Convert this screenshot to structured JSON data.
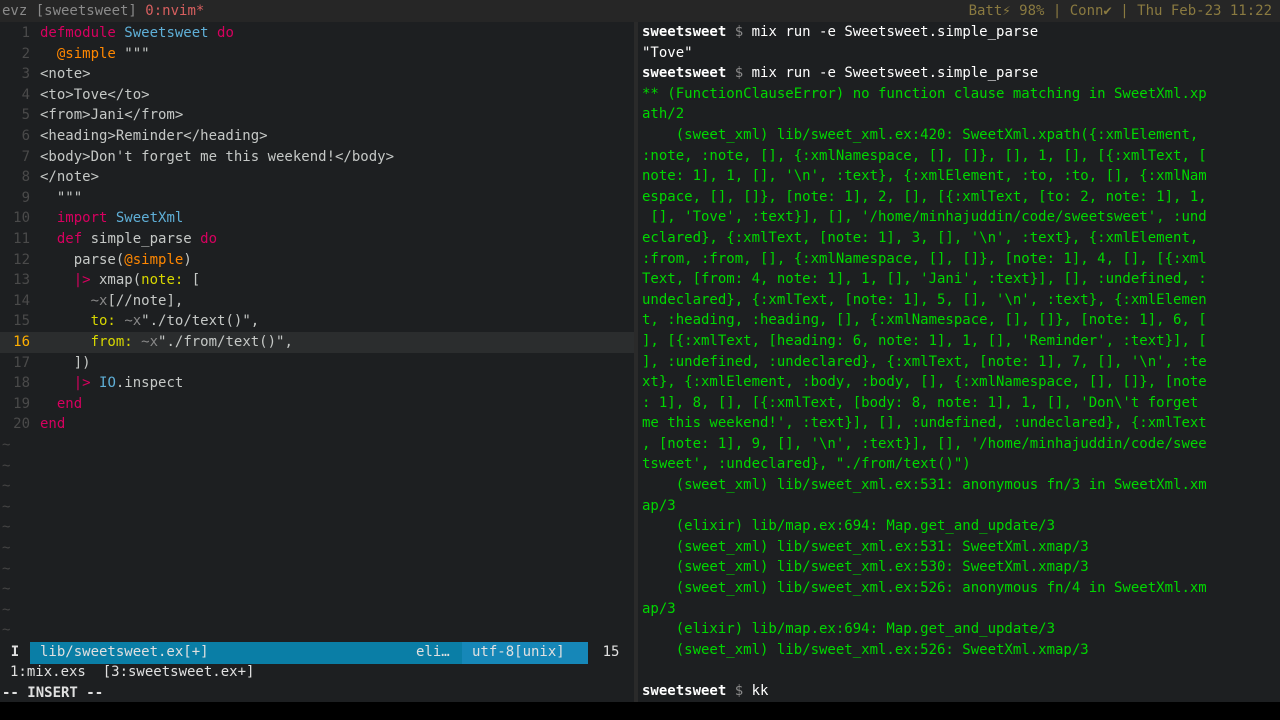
{
  "tmux": {
    "session": "evz [sweetsweet]",
    "window": "0:nvim*",
    "status_right": "Batt⚡ 98% | Conn✔ | Thu Feb-23 11:22"
  },
  "editor": {
    "lines": [
      {
        "n": "1",
        "text": "defmodule Sweetsweet do"
      },
      {
        "n": "2",
        "text": "  @simple \"\"\""
      },
      {
        "n": "3",
        "text": "<note>"
      },
      {
        "n": "4",
        "text": "<to>Tove</to>"
      },
      {
        "n": "5",
        "text": "<from>Jani</from>"
      },
      {
        "n": "6",
        "text": "<heading>Reminder</heading>"
      },
      {
        "n": "7",
        "text": "<body>Don't forget me this weekend!</body>"
      },
      {
        "n": "8",
        "text": "</note>"
      },
      {
        "n": "9",
        "text": "  \"\"\""
      },
      {
        "n": "10",
        "text": "  import SweetXml"
      },
      {
        "n": "11",
        "text": "  def simple_parse do"
      },
      {
        "n": "12",
        "text": "    parse(@simple)"
      },
      {
        "n": "13",
        "text": "    |> xmap(note: ["
      },
      {
        "n": "14",
        "text": "      ~x[//note],"
      },
      {
        "n": "15",
        "text": "      to: ~x\"./to/text()\","
      },
      {
        "n": "16",
        "text": "      from: ~x\"./from/text()\","
      },
      {
        "n": "17",
        "text": "    ])"
      },
      {
        "n": "18",
        "text": "    |> IO.inspect"
      },
      {
        "n": "19",
        "text": "  end"
      },
      {
        "n": "20",
        "text": "end"
      }
    ],
    "current_line": "16",
    "tilde": "~",
    "status": {
      "mode_char": "I",
      "file": "lib/sweetsweet.ex[+]",
      "filetype": "eli…",
      "encoding": "utf-8[unix]",
      "position": "15"
    },
    "buffers": "1:mix.exs  [3:sweetsweet.ex+]",
    "mode_line": "-- INSERT --"
  },
  "terminal": {
    "prompt_user": "sweetsweet",
    "prompt_symbol": "$",
    "cmd1": "mix run -e Sweetsweet.simple_parse",
    "out1": "\"Tove\"",
    "cmd2": "mix run -e Sweetsweet.simple_parse",
    "error_lines": [
      "** (FunctionClauseError) no function clause matching in SweetXml.xp",
      "ath/2",
      "    (sweet_xml) lib/sweet_xml.ex:420: SweetXml.xpath({:xmlElement,",
      ":note, :note, [], {:xmlNamespace, [], []}, [], 1, [], [{:xmlText, [",
      "note: 1], 1, [], '\\n', :text}, {:xmlElement, :to, :to, [], {:xmlNam",
      "espace, [], []}, [note: 1], 2, [], [{:xmlText, [to: 2, note: 1], 1,",
      " [], 'Tove', :text}], [], '/home/minhajuddin/code/sweetsweet', :und",
      "eclared}, {:xmlText, [note: 1], 3, [], '\\n', :text}, {:xmlElement,",
      ":from, :from, [], {:xmlNamespace, [], []}, [note: 1], 4, [], [{:xml",
      "Text, [from: 4, note: 1], 1, [], 'Jani', :text}], [], :undefined, :",
      "undeclared}, {:xmlText, [note: 1], 5, [], '\\n', :text}, {:xmlElemen",
      "t, :heading, :heading, [], {:xmlNamespace, [], []}, [note: 1], 6, [",
      "], [{:xmlText, [heading: 6, note: 1], 1, [], 'Reminder', :text}], [",
      "], :undefined, :undeclared}, {:xmlText, [note: 1], 7, [], '\\n', :te",
      "xt}, {:xmlElement, :body, :body, [], {:xmlNamespace, [], []}, [note",
      ": 1], 8, [], [{:xmlText, [body: 8, note: 1], 1, [], 'Don\\'t forget",
      "me this weekend!', :text}], [], :undefined, :undeclared}, {:xmlText",
      ", [note: 1], 9, [], '\\n', :text}], [], '/home/minhajuddin/code/swee",
      "tsweet', :undeclared}, \"./from/text()\")",
      "    (sweet_xml) lib/sweet_xml.ex:531: anonymous fn/3 in SweetXml.xm",
      "ap/3",
      "    (elixir) lib/map.ex:694: Map.get_and_update/3",
      "    (sweet_xml) lib/sweet_xml.ex:531: SweetXml.xmap/3",
      "    (sweet_xml) lib/sweet_xml.ex:530: SweetXml.xmap/3",
      "    (sweet_xml) lib/sweet_xml.ex:526: anonymous fn/4 in SweetXml.xm",
      "ap/3",
      "    (elixir) lib/map.ex:694: Map.get_and_update/3",
      "    (sweet_xml) lib/sweet_xml.ex:526: SweetXml.xmap/3"
    ],
    "cmd3": "kk"
  }
}
